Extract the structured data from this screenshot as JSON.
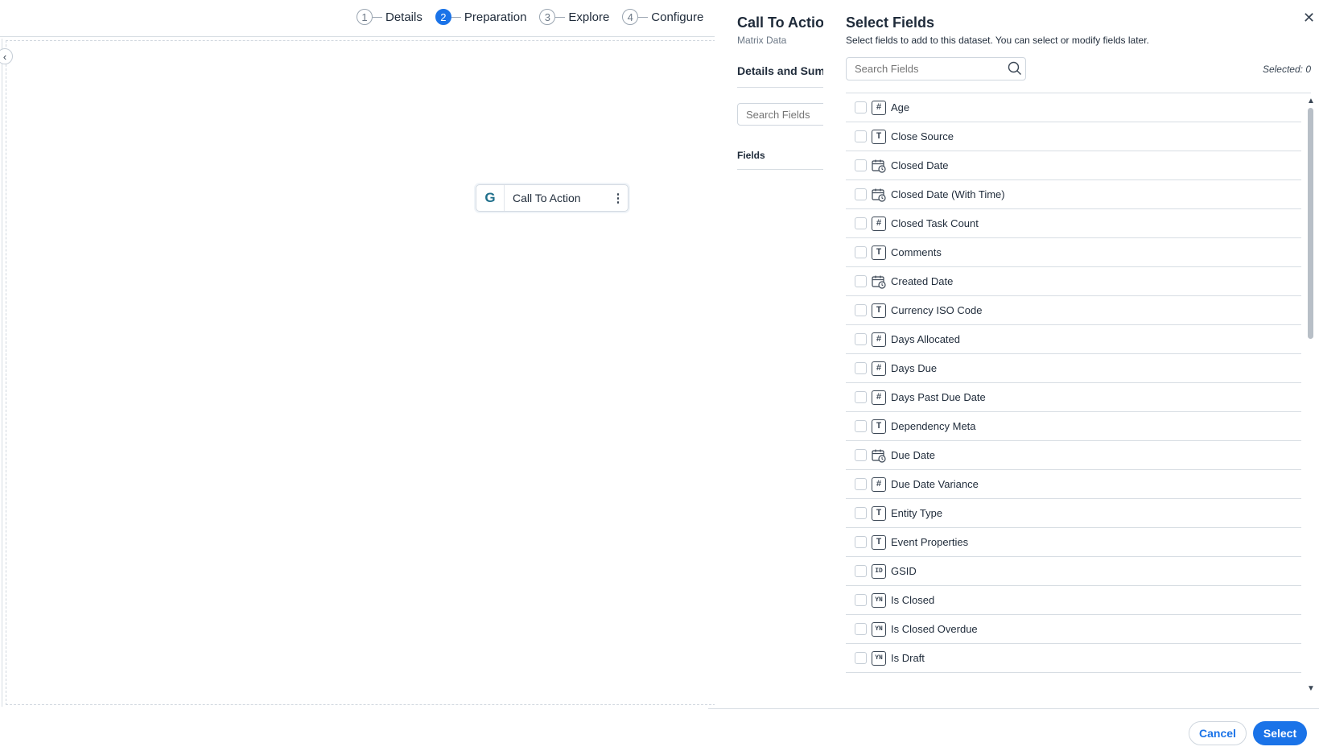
{
  "stepper": {
    "steps": [
      {
        "num": "1",
        "label": "Details"
      },
      {
        "num": "2",
        "label": "Preparation"
      },
      {
        "num": "3",
        "label": "Explore"
      },
      {
        "num": "4",
        "label": "Configure"
      }
    ],
    "active_step": 1
  },
  "canvas": {
    "node": {
      "icon": "G",
      "label": "Call To Action",
      "menu_icon": "⋮"
    }
  },
  "middle_panel": {
    "title": "Call To Action",
    "subtitle": "Matrix Data",
    "section": "Details and Summ",
    "search_placeholder": "Search Fields",
    "fields_label": "Fields"
  },
  "dialog": {
    "title": "Select Fields",
    "description": "Select fields to add to this dataset. You can select or modify fields later.",
    "search_placeholder": "Search Fields",
    "selected_label": "Selected: 0",
    "fields": [
      {
        "name": "Age",
        "type": "number",
        "icon": "#"
      },
      {
        "name": "Close Source",
        "type": "text",
        "icon": "T"
      },
      {
        "name": "Closed Date",
        "type": "date",
        "icon": "date"
      },
      {
        "name": "Closed Date (With Time)",
        "type": "datetime",
        "icon": "date"
      },
      {
        "name": "Closed Task Count",
        "type": "number",
        "icon": "#"
      },
      {
        "name": "Comments",
        "type": "text",
        "icon": "T"
      },
      {
        "name": "Created Date",
        "type": "date",
        "icon": "date"
      },
      {
        "name": "Currency ISO Code",
        "type": "text",
        "icon": "T"
      },
      {
        "name": "Days Allocated",
        "type": "number",
        "icon": "#"
      },
      {
        "name": "Days Due",
        "type": "number",
        "icon": "#"
      },
      {
        "name": "Days Past Due Date",
        "type": "number",
        "icon": "#"
      },
      {
        "name": "Dependency Meta",
        "type": "text",
        "icon": "T"
      },
      {
        "name": "Due Date",
        "type": "date",
        "icon": "date"
      },
      {
        "name": "Due Date Variance",
        "type": "number",
        "icon": "#"
      },
      {
        "name": "Entity Type",
        "type": "text",
        "icon": "T"
      },
      {
        "name": "Event Properties",
        "type": "text",
        "icon": "T"
      },
      {
        "name": "GSID",
        "type": "id",
        "icon": "ID"
      },
      {
        "name": "Is Closed",
        "type": "boolean",
        "icon": "YN"
      },
      {
        "name": "Is Closed Overdue",
        "type": "boolean",
        "icon": "YN"
      },
      {
        "name": "Is Draft",
        "type": "boolean",
        "icon": "YN"
      }
    ],
    "buttons": {
      "cancel": "Cancel",
      "select": "Select"
    }
  },
  "colors": {
    "accent": "#1a73e8",
    "border": "#d7dde3"
  }
}
